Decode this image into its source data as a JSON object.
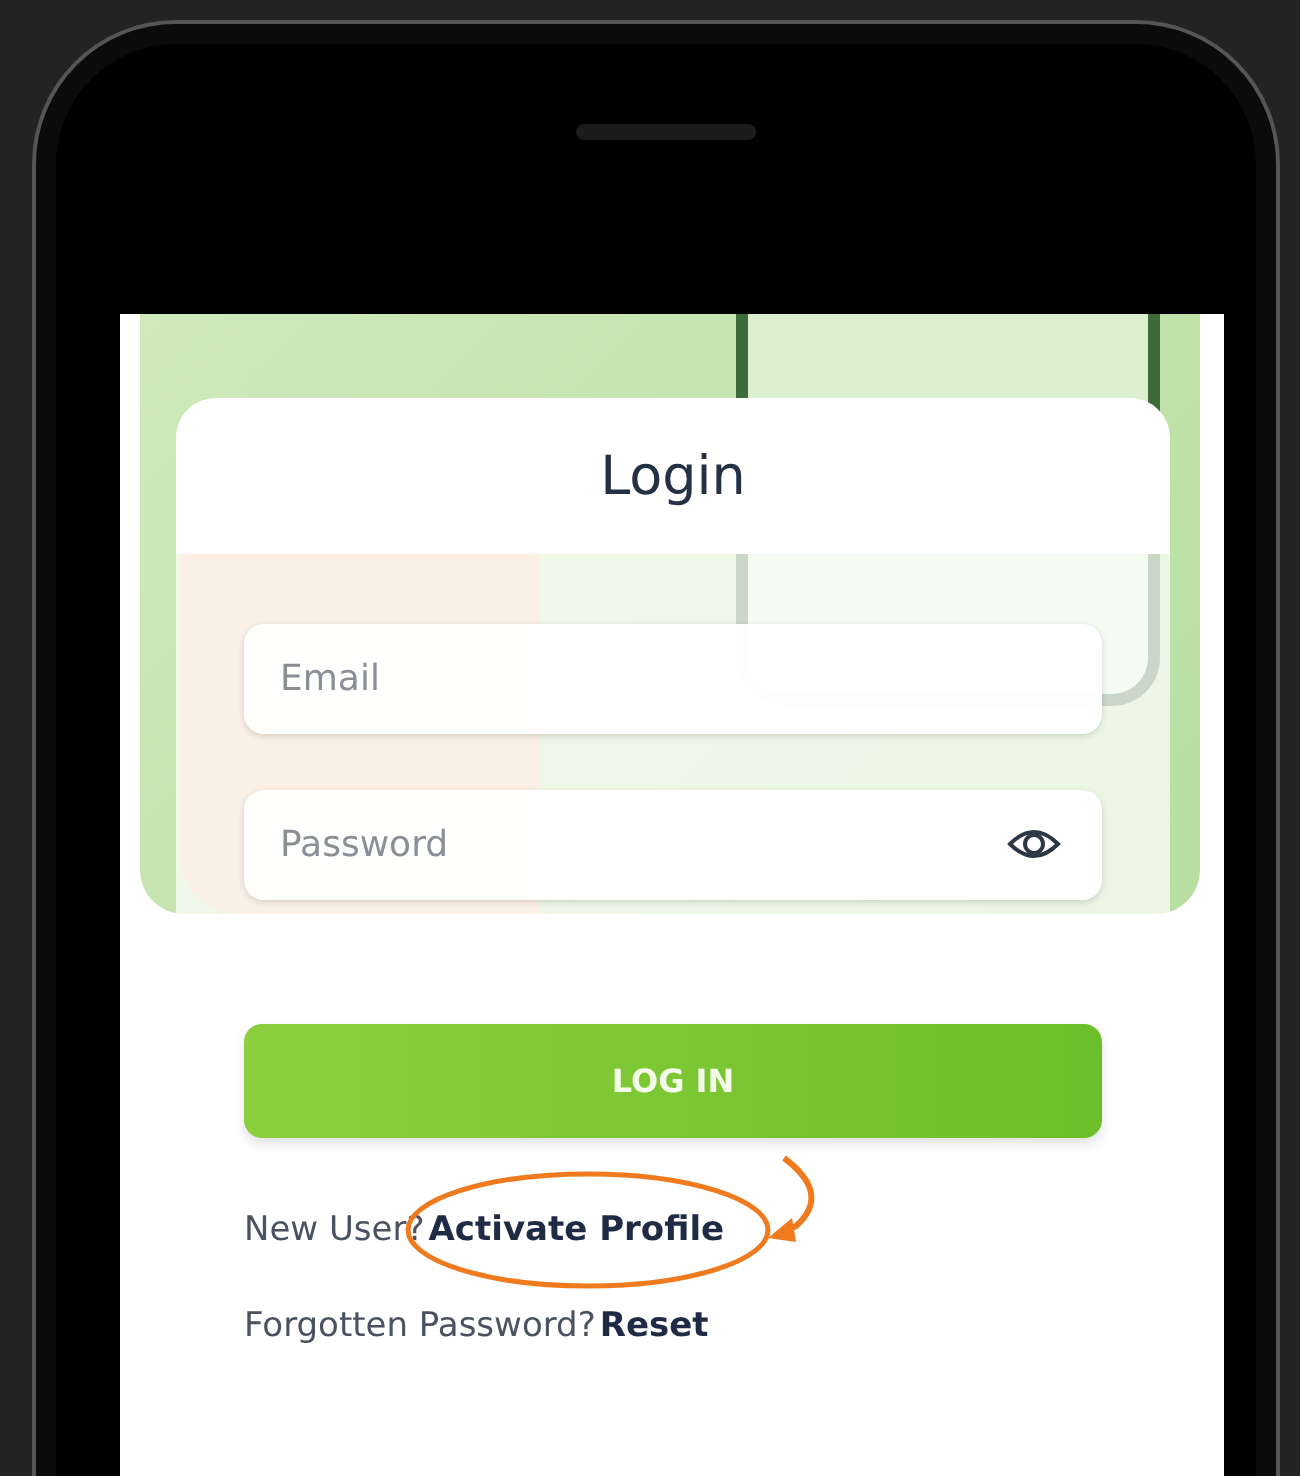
{
  "title": "Login",
  "fields": [
    {
      "kind": "text",
      "placeholder": "Email"
    },
    {
      "kind": "password",
      "placeholder": "Password"
    }
  ],
  "login_button": "LOG IN",
  "prompts": [
    {
      "text": "New User?",
      "link": "Activate Profile",
      "highlighted": true
    },
    {
      "text": "Forgotten Password?",
      "link": "Reset",
      "highlighted": false
    }
  ]
}
